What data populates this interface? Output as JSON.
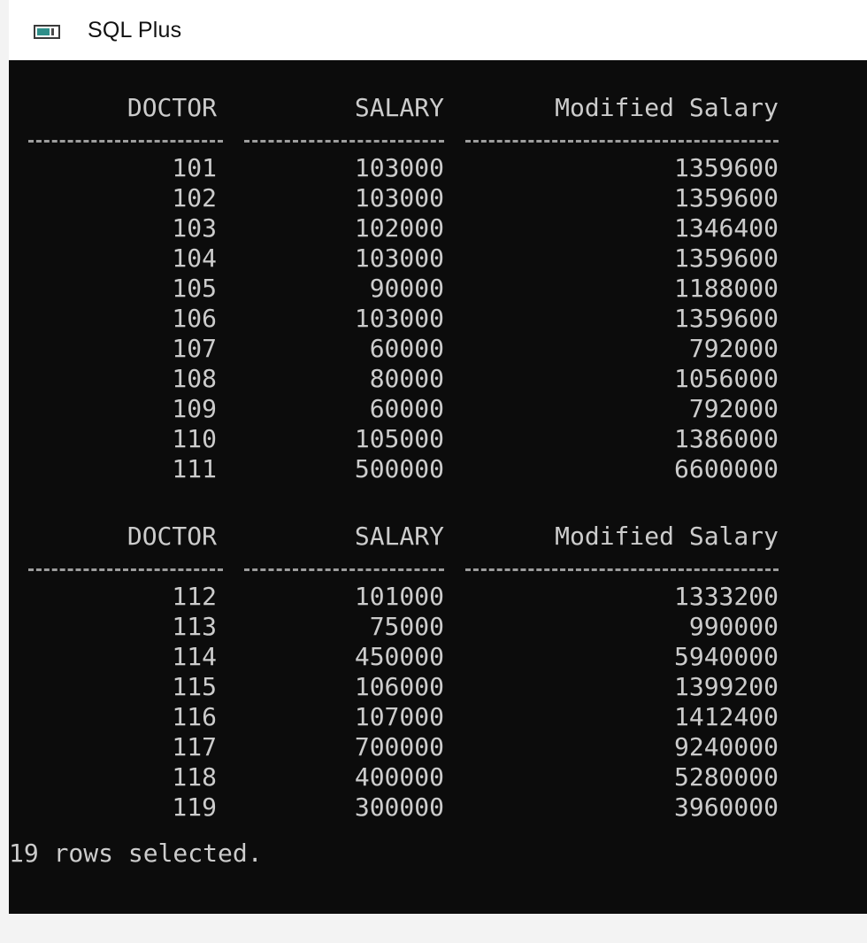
{
  "window": {
    "title": "SQL Plus",
    "icon_name": "console-window-icon"
  },
  "query_result": {
    "headers": [
      "DOCTOR",
      "SALARY",
      "Modified Salary"
    ],
    "page_1_rows": [
      [
        "101",
        "103000",
        "1359600"
      ],
      [
        "102",
        "103000",
        "1359600"
      ],
      [
        "103",
        "102000",
        "1346400"
      ],
      [
        "104",
        "103000",
        "1359600"
      ],
      [
        "105",
        "90000",
        "1188000"
      ],
      [
        "106",
        "103000",
        "1359600"
      ],
      [
        "107",
        "60000",
        "792000"
      ],
      [
        "108",
        "80000",
        "1056000"
      ],
      [
        "109",
        "60000",
        "792000"
      ],
      [
        "110",
        "105000",
        "1386000"
      ],
      [
        "111",
        "500000",
        "6600000"
      ]
    ],
    "page_2_rows": [
      [
        "112",
        "101000",
        "1333200"
      ],
      [
        "113",
        "75000",
        "990000"
      ],
      [
        "114",
        "450000",
        "5940000"
      ],
      [
        "115",
        "106000",
        "1399200"
      ],
      [
        "116",
        "107000",
        "1412400"
      ],
      [
        "117",
        "700000",
        "9240000"
      ],
      [
        "118",
        "400000",
        "5280000"
      ],
      [
        "119",
        "300000",
        "3960000"
      ]
    ],
    "status": "19 rows selected."
  },
  "colors": {
    "console_background": "#0c0c0c",
    "console_text": "#cccccc",
    "titlebar_background": "#ffffff"
  }
}
